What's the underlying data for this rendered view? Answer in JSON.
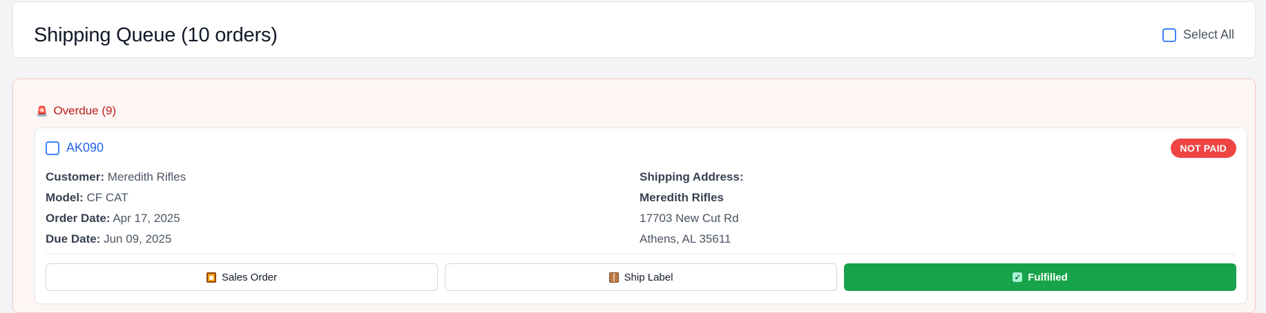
{
  "header": {
    "title": "Shipping Queue (10 orders)",
    "select_all_label": "Select All"
  },
  "section": {
    "icon": "siren-icon",
    "label": "Overdue (9)",
    "color": "#b91c1c"
  },
  "order": {
    "id": "AK090",
    "status": "NOT PAID",
    "status_color": "#ef4444",
    "details": [
      {
        "key": "Customer:",
        "value": "Meredith Rifles"
      },
      {
        "key": "Model:",
        "value": "CF CAT"
      },
      {
        "key": "Order Date:",
        "value": "Apr 17, 2025"
      },
      {
        "key": "Due Date:",
        "value": "Jun 09, 2025"
      }
    ],
    "shipping": {
      "heading": "Shipping Address:",
      "name": "Meredith Rifles",
      "street": "17703 New Cut Rd",
      "city_state_zip": "Athens, AL 35611"
    },
    "actions": {
      "sales_order": "Sales Order",
      "ship_label": "Ship Label",
      "fulfilled": "Fulfilled",
      "fulfilled_color": "#16a34a"
    }
  }
}
